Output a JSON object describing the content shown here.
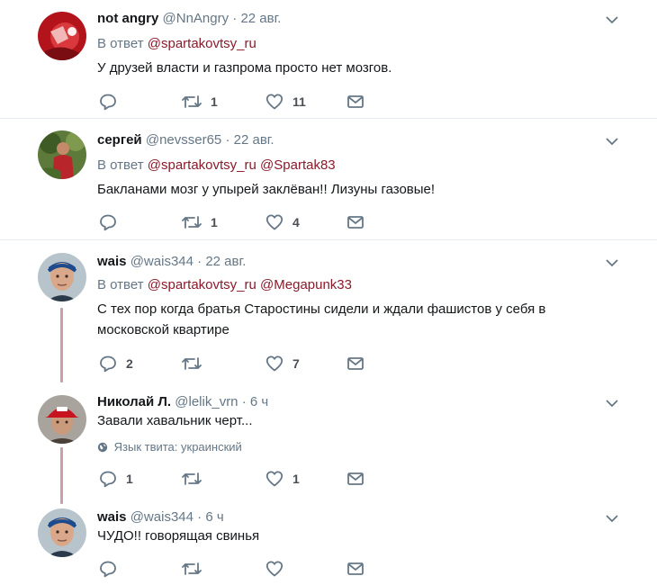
{
  "reply_prefix": "В ответ",
  "tweets": [
    {
      "name": "not angry",
      "handle": "@NnAngry",
      "time": "22 авг.",
      "reply_to": [
        "@spartakovtsy_ru"
      ],
      "text": "У друзей власти и газпрома просто нет мозгов.",
      "replies": "",
      "retweets": "1",
      "likes": "11"
    },
    {
      "name": "сергей",
      "handle": "@nevsser65",
      "time": "22 авг.",
      "reply_to": [
        "@spartakovtsy_ru",
        "@Spartak83"
      ],
      "text": "Бакланами мозг у упырей заклёван!! Лизуны газовые!",
      "replies": "",
      "retweets": "1",
      "likes": "4"
    },
    {
      "name": "wais",
      "handle": "@wais344",
      "time": "22 авг.",
      "reply_to": [
        "@spartakovtsy_ru",
        "@Megapunk33"
      ],
      "text": "С тех пор когда братья Старостины сидели и ждали фашистов у себя в московской квартире",
      "replies": "2",
      "retweets": "",
      "likes": "7"
    },
    {
      "name": "Николай Л.",
      "handle": "@lelik_vrn",
      "time": "6 ч",
      "text": "Завали хавальник черт...",
      "lang_label": "Язык твита: украинский",
      "replies": "1",
      "retweets": "",
      "likes": "1"
    },
    {
      "name": "wais",
      "handle": "@wais344",
      "time": "6 ч",
      "text": "ЧУДО!! говорящая свинья",
      "replies": "",
      "retweets": "",
      "likes": ""
    }
  ],
  "colors": {
    "mention": "#8b1a2b",
    "secondary": "#657786",
    "icon": "#657786",
    "thread_line": "#c9a0a8",
    "divider": "#e6ecf0"
  },
  "icons": [
    "reply-icon",
    "retweet-icon",
    "like-icon",
    "message-icon",
    "caret-down-icon",
    "globe-icon"
  ]
}
